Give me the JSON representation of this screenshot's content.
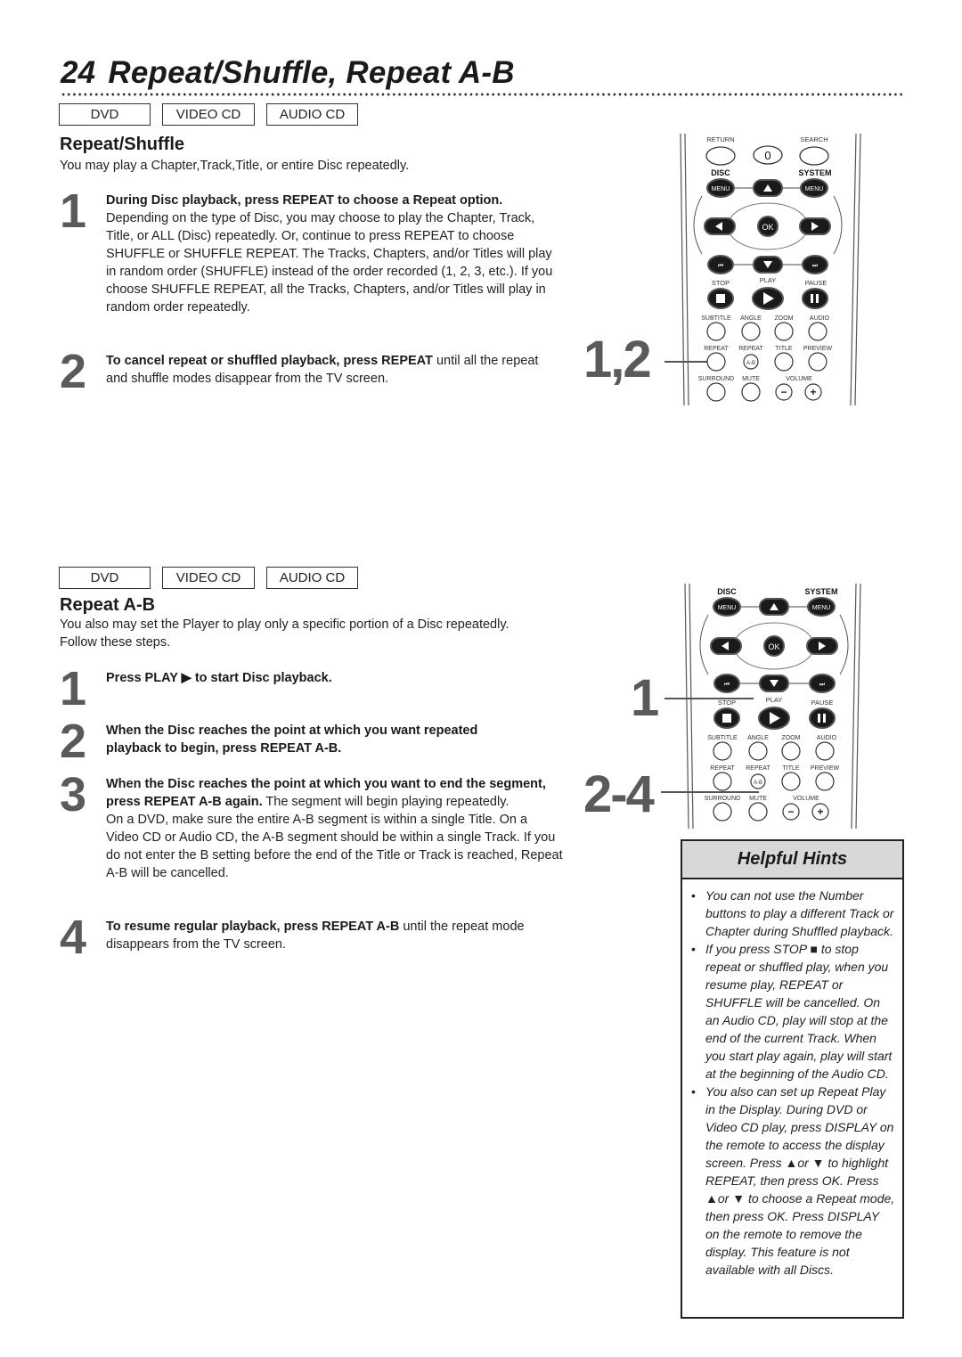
{
  "header": {
    "page_number": "24",
    "title": "Repeat/Shuffle, Repeat A-B"
  },
  "disc_badges": [
    "DVD",
    "VIDEO CD",
    "AUDIO CD"
  ],
  "repeat_shuffle": {
    "title": "Repeat/Shuffle",
    "intro": "You may play a Chapter,Track,Title, or entire Disc repeatedly.",
    "steps": [
      {
        "number": "1",
        "bold": "During Disc playback, press REPEAT to choose a Repeat option.",
        "text": " Depending on the type of Disc, you may choose to play the Chapter, Track, Title, or ALL (Disc) repeatedly. Or, continue to press REPEAT to choose SHUFFLE or SHUFFLE REPEAT. The Tracks, Chapters, and/or Titles will play in random order (SHUFFLE) instead of the order recorded (1, 2, 3, etc.). If you choose SHUFFLE REPEAT, all the Tracks, Chapters, and/or Titles will play in random order repeatedly."
      },
      {
        "number": "2",
        "bold": "To cancel repeat or shuffled playback, press REPEAT",
        "text": " until all the repeat and shuffle modes disappear from the TV screen."
      }
    ],
    "callout": "1,2"
  },
  "repeat_ab": {
    "title": "Repeat A-B",
    "intro": "You also may set the Player to play only a specific portion of a Disc repeatedly. Follow these steps.",
    "steps": [
      {
        "number": "1",
        "bold": "Press PLAY ▶ to start Disc playback.",
        "text": ""
      },
      {
        "number": "2",
        "bold": "When the Disc reaches the point at which you want repeated playback to begin, press REPEAT A-B.",
        "text": ""
      },
      {
        "number": "3",
        "bold": "When the Disc reaches the point at which you want to end the segment, press REPEAT A-B again.",
        "text": " The segment will begin playing repeatedly.",
        "extra": "On a DVD, make sure the entire A-B segment is within a single Title. On a Video CD or Audio CD, the A-B segment should be within a single Track. If you do not enter the B setting before the end of the Title or Track is reached, Repeat A-B will be cancelled."
      },
      {
        "number": "4",
        "bold": "To resume regular playback, press REPEAT A-B",
        "text": " until the repeat mode disappears from the TV screen."
      }
    ],
    "callout_1": "1",
    "callout_2": "2-4"
  },
  "remote_labels": {
    "return": "RETURN",
    "search": "SEARCH",
    "zero": "0",
    "disc": "DISC",
    "system": "SYSTEM",
    "menu": "MENU",
    "ok": "OK",
    "stop": "STOP",
    "play": "PLAY",
    "pause": "PAUSE",
    "subtitle": "SUBTITLE",
    "angle": "ANGLE",
    "zoom": "ZOOM",
    "audio": "AUDIO",
    "repeat": "REPEAT",
    "repeat_ab": "REPEAT",
    "ab": "A-B",
    "title": "TITLE",
    "preview": "PREVIEW",
    "surround": "SURROUND",
    "mute": "MUTE",
    "volume": "VOLUME",
    "minus": "−",
    "plus": "+"
  },
  "helpful_hints": {
    "title": "Helpful Hints",
    "items": [
      "You can not use the Number buttons to play a different Track or Chapter during Shuffled playback.",
      "If you press STOP ■ to stop repeat or shuffled play, when you resume play, REPEAT or SHUFFLE will be cancelled. On an Audio CD, play will stop at the end of the current Track. When you start play again, play will start at the beginning of the Audio CD.",
      "You also can set up Repeat Play in the Display. During DVD or Video CD play, press DISPLAY on the remote to access the display screen. Press ▲or ▼ to highlight REPEAT, then press OK. Press ▲or ▼ to choose a Repeat mode, then press OK. Press DISPLAY on the remote to remove the display. This feature is not available with all Discs."
    ]
  }
}
